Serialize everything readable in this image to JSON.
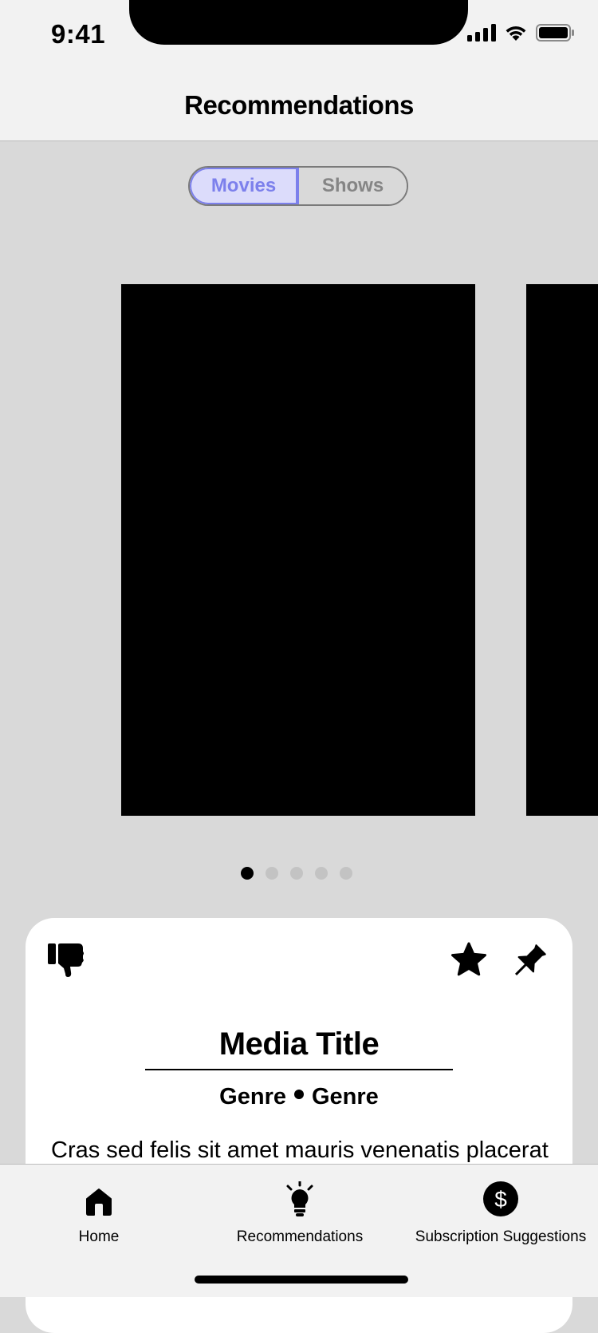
{
  "status_bar": {
    "time": "9:41"
  },
  "header": {
    "title": "Recommendations"
  },
  "segment": {
    "options": [
      "Movies",
      "Shows"
    ],
    "selected": "Movies"
  },
  "carousel": {
    "page_count": 5,
    "current_page": 1
  },
  "card": {
    "media_title": "Media Title",
    "genres": [
      "Genre",
      "Genre"
    ],
    "description": "Cras sed felis sit amet mauris venenatis placerat"
  },
  "tab_bar": {
    "home": "Home",
    "recommendations": "Recommendations",
    "subscriptions": "Subscription Suggestions"
  },
  "colors": {
    "accent": "#7c80ec",
    "accent_bg": "#dcdcfb",
    "page_bg": "#d9d9d9",
    "bar_bg": "#f2f2f2"
  },
  "icons": [
    "signal-icon",
    "wifi-icon",
    "battery-icon",
    "thumbs-down-icon",
    "star-icon",
    "pin-icon",
    "home-icon",
    "lightbulb-icon",
    "dollar-icon"
  ]
}
